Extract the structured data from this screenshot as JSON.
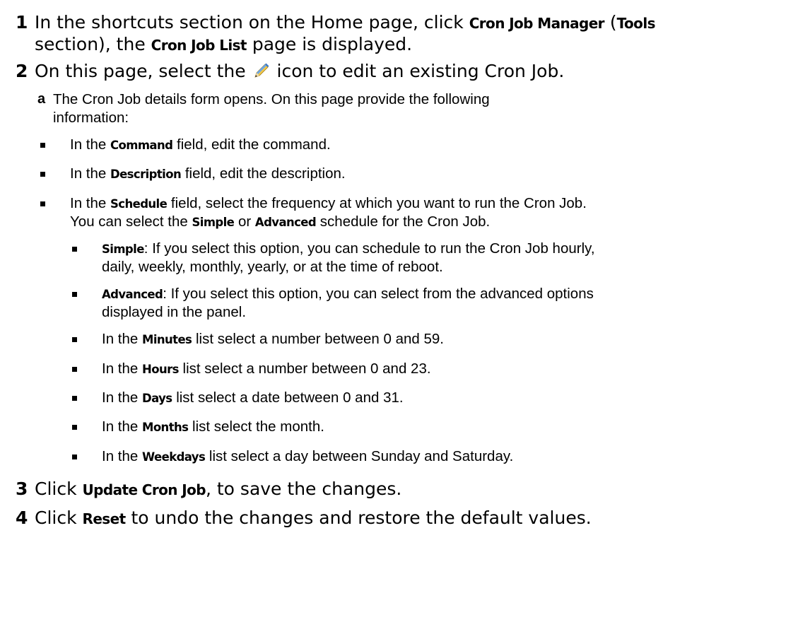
{
  "steps": [
    {
      "num": "1",
      "line1": {
        "a": "In the shortcuts section on the Home page, click ",
        "b": "Cron Job Manager",
        "c": " (",
        "d": "Tools"
      },
      "line2": {
        "a": "section), the ",
        "b": "Cron Job List",
        "c": " page is displayed."
      }
    },
    {
      "num": "2",
      "a": "On this page, select the ",
      "icon": "pencil-edit-icon",
      "b": " icon to edit an existing Cron Job."
    },
    {
      "num": "3",
      "a": "Click ",
      "b": "Update Cron Job",
      "c": ", to save the changes."
    },
    {
      "num": "4",
      "a": "Click ",
      "b": "Reset",
      "c": " to undo the changes and restore the default values."
    }
  ],
  "substep_a": {
    "letter": "a",
    "line1": "The Cron Job details form opens. On this page provide the following",
    "line2": "information:"
  },
  "bullets": {
    "command": {
      "a": "In the ",
      "b": "Command",
      "c": " field, edit the command."
    },
    "description": {
      "a": "In the ",
      "b": "Description",
      "c": " field, edit the description."
    },
    "schedule": {
      "a": "In the ",
      "b": "Schedule",
      "c": " field, select the frequency at which you want to run the Cron Job.",
      "l2a": "You can select the ",
      "l2b": "Simple",
      "l2c": " or ",
      "l2d": "Advanced",
      "l2e": " schedule for the Cron Job."
    },
    "simple": {
      "b": "Simple",
      "c": ": If you select this option, you can schedule to run the Cron Job hourly,",
      "l2": "daily, weekly, monthly, yearly, or at the time of reboot."
    },
    "advanced": {
      "b": "Advanced",
      "c": ": If you select this option, you can select from the advanced options",
      "l2": "displayed in the panel."
    },
    "minutes": {
      "a": "In the ",
      "b": "Minutes",
      "c": " list select a number between 0 and 59."
    },
    "hours": {
      "a": "In the ",
      "b": "Hours",
      "c": " list select a number between 0 and 23."
    },
    "days": {
      "a": "In the ",
      "b": "Days",
      "c": " list select a date between 0 and 31."
    },
    "months": {
      "a": "In the ",
      "b": "Months",
      "c": " list select the month."
    },
    "weekdays": {
      "a": "In the ",
      "b": "Weekdays",
      "c": " list select a day between Sunday and Saturday."
    }
  }
}
